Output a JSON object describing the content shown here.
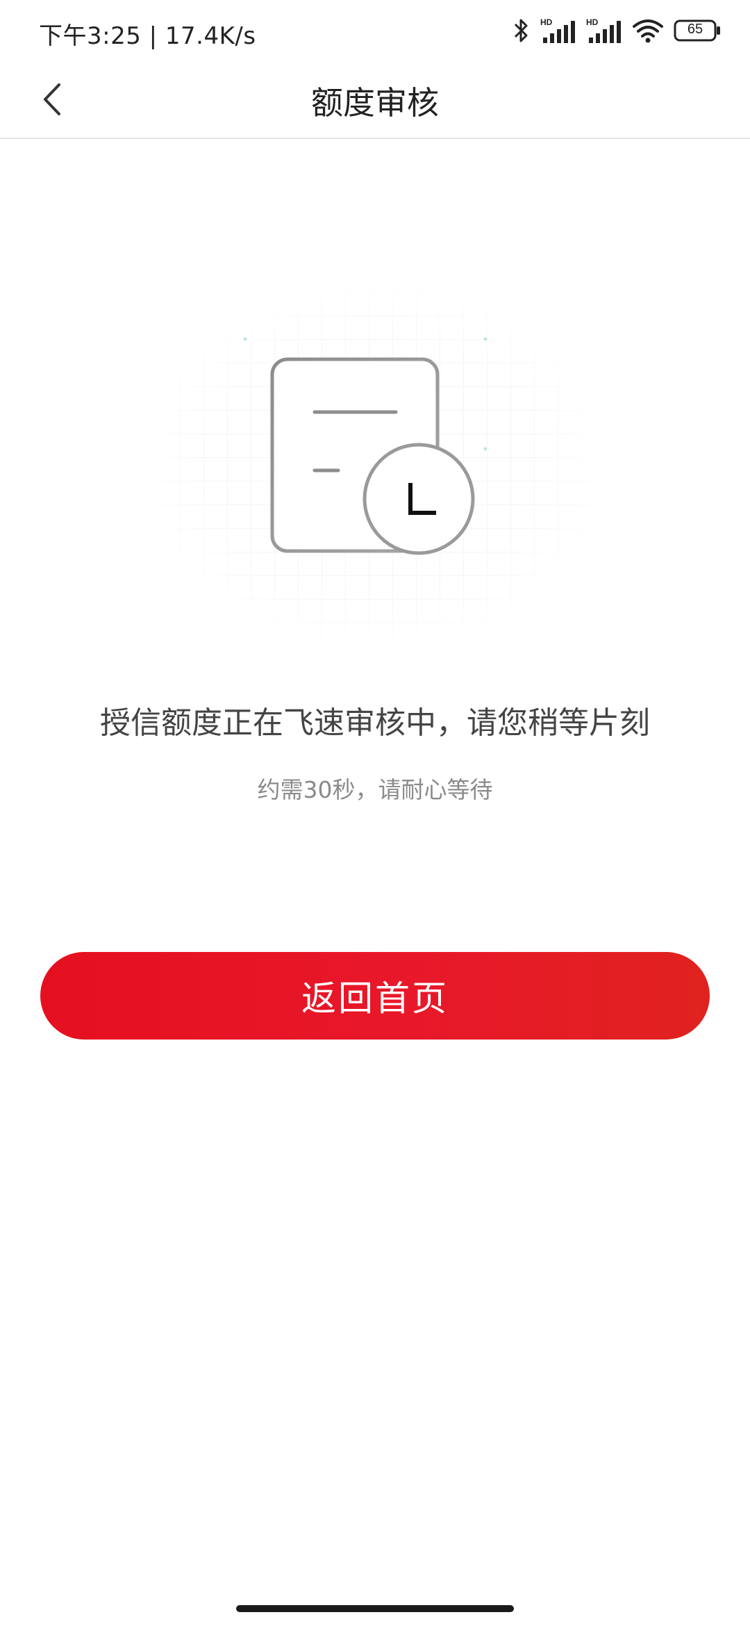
{
  "status_bar": {
    "time_speed": "下午3:25 | 17.4K/s",
    "battery": "65",
    "hd_label_1": "HD",
    "hd_label_2": "HD"
  },
  "header": {
    "title": "额度审核",
    "back_icon": "chevron-left-icon"
  },
  "main": {
    "illustration": "document-clock-icon",
    "message": "授信额度正在飞速审核中，请您稍等片刻",
    "sub_message": "约需30秒，请耐心等待"
  },
  "actions": {
    "home_button_label": "返回首页",
    "button_color": "#e5101f"
  }
}
